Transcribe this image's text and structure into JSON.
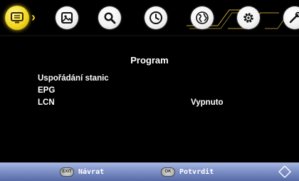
{
  "menu_tabs": [
    {
      "id": "program",
      "icon": "tv-menu-icon",
      "active": true
    },
    {
      "id": "picture",
      "icon": "picture-icon",
      "active": false
    },
    {
      "id": "search",
      "icon": "search-icon",
      "active": false
    },
    {
      "id": "time",
      "icon": "clock-icon",
      "active": false
    },
    {
      "id": "option",
      "icon": "globe-icon",
      "active": false
    },
    {
      "id": "setup",
      "icon": "gear-icon",
      "active": false
    },
    {
      "id": "tools",
      "icon": "tools-icon",
      "active": false
    }
  ],
  "colors": {
    "accent": "#f2cf1a",
    "bottom_bar": "#7f92c8",
    "background": "#000000"
  },
  "page": {
    "title": "Program",
    "items": [
      {
        "label": "Uspořádání stanic",
        "value": ""
      },
      {
        "label": "EPG",
        "value": ""
      },
      {
        "label": "LCN",
        "value": "Vypnuto"
      }
    ]
  },
  "help_bar": {
    "back_key": "EXIT",
    "back_label": "Návrat",
    "ok_key": "OK",
    "ok_label": "Potvrdit"
  }
}
